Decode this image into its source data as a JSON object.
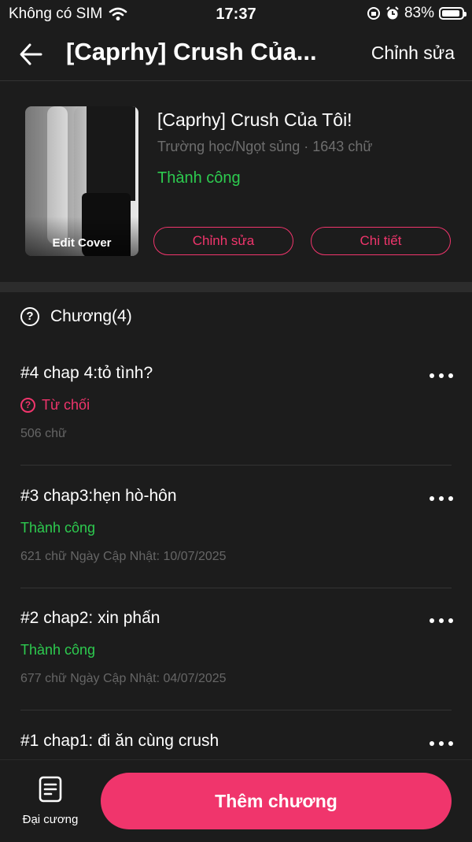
{
  "status_bar": {
    "carrier": "Không có SIM",
    "time": "17:37",
    "battery": "83%"
  },
  "nav": {
    "title": "[Caprhy] Crush Của...",
    "edit_label": "Chỉnh sửa"
  },
  "book": {
    "cover_label": "Edit Cover",
    "title": "[Caprhy] Crush Của Tôi!",
    "meta": "Trường học/Ngọt sủng · 1643 chữ",
    "status": "Thành công",
    "edit_button": "Chỉnh sửa",
    "detail_button": "Chi tiết"
  },
  "chapters": {
    "header": "Chương(4)",
    "items": [
      {
        "title": "#4 chap 4:tỏ tình?",
        "status": "Từ chối",
        "info": "506 chữ"
      },
      {
        "title": "#3 chap3:hẹn hò-hôn",
        "status": "Thành công",
        "info": "621 chữ Ngày Cập Nhật: 10/07/2025"
      },
      {
        "title": "#2 chap2: xin phấn",
        "status": "Thành công",
        "info": "677 chữ Ngày Cập Nhật: 04/07/2025"
      },
      {
        "title": "#1 chap1: đi ăn cùng crush"
      }
    ]
  },
  "bottom": {
    "outline_label": "Đại cương",
    "add_chapter": "Thêm chương"
  },
  "colors": {
    "accent": "#f0356c",
    "success": "#2dcb4f",
    "background": "#1c1c1c"
  }
}
